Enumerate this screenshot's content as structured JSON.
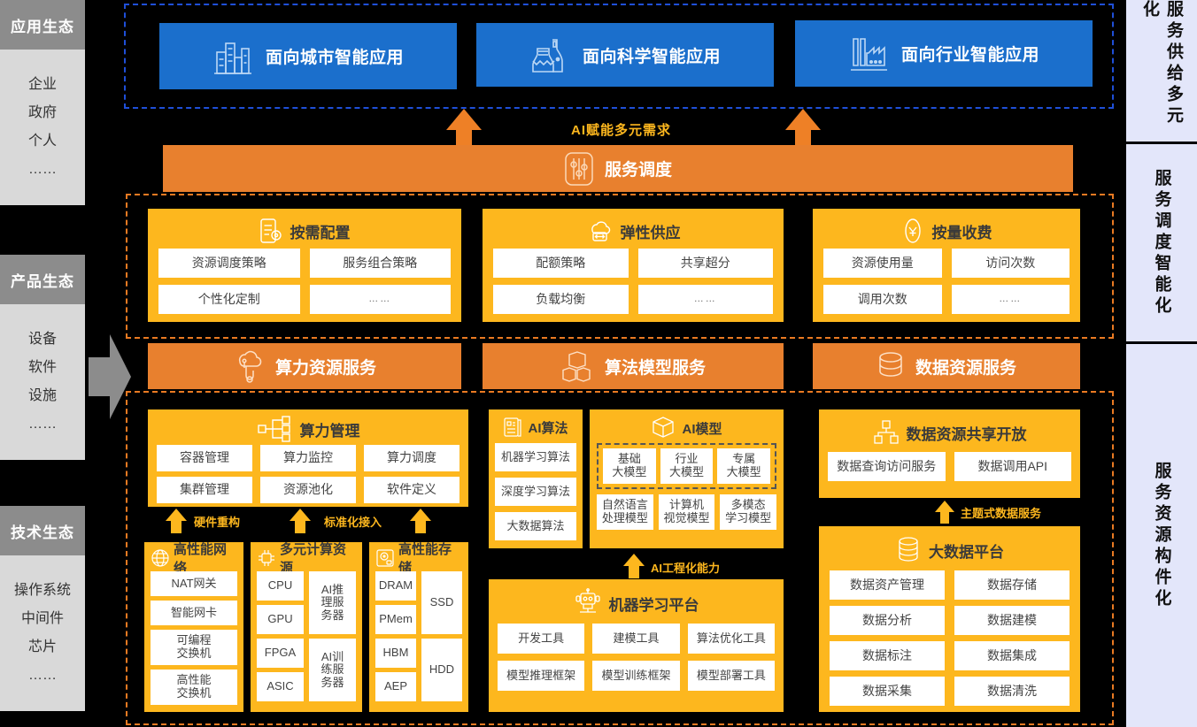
{
  "left_rail": [
    {
      "title": "应用生态",
      "items": [
        "企业",
        "政府",
        "个人",
        "……"
      ]
    },
    {
      "title": "产品生态",
      "items": [
        "设备",
        "软件",
        "设施",
        "……"
      ]
    },
    {
      "title": "技术生态",
      "items": [
        "操作系统",
        "中间件",
        "芯片",
        "……"
      ]
    }
  ],
  "right_rail": [
    "服务供给多元化",
    "服务调度智能化",
    "服务资源构件化"
  ],
  "applications": [
    {
      "label": "面向城市智能应用",
      "icon": "city-buildings-icon"
    },
    {
      "label": "面向科学智能应用",
      "icon": "science-flask-icon"
    },
    {
      "label": "面向行业智能应用",
      "icon": "factory-icon"
    }
  ],
  "connector_labels": {
    "ai_demand": "AI赋能多元需求",
    "hardware_reconstruct": "硬件重构",
    "standard_access": "标准化接入",
    "ai_engineering": "AI工程化能力",
    "thematic_data_service": "主题式数据服务"
  },
  "service_schedule": {
    "label": "服务调度",
    "icon": "sliders-icon"
  },
  "policy_cards": [
    {
      "title": "按需配置",
      "icon": "config-list-icon",
      "items": [
        "资源调度策略",
        "服务组合策略",
        "个性化定制",
        "……"
      ]
    },
    {
      "title": "弹性供应",
      "icon": "elastic-cloud-icon",
      "items": [
        "配额策略",
        "共享超分",
        "负载均衡",
        "……"
      ]
    },
    {
      "title": "按量收费",
      "icon": "yuan-coin-icon",
      "items": [
        "资源使用量",
        "访问次数",
        "调用次数",
        "……"
      ]
    }
  ],
  "service_bars": [
    {
      "label": "算力资源服务",
      "icon": "cloud-compute-icon"
    },
    {
      "label": "算法模型服务",
      "icon": "cubes-icon"
    },
    {
      "label": "数据资源服务",
      "icon": "database-icon"
    }
  ],
  "compute": {
    "management": {
      "title": "算力管理",
      "icon": "network-nodes-icon",
      "items": [
        "容器管理",
        "算力监控",
        "算力调度",
        "集群管理",
        "资源池化",
        "软件定义"
      ]
    },
    "network": {
      "title": "高性能网络",
      "icon": "globe-network-icon",
      "items": [
        "NAT网关",
        "智能网卡",
        "可编程\n交换机",
        "高性能\n交换机"
      ]
    },
    "compute_res": {
      "title": "多元计算资源",
      "icon": "chip-icon",
      "left": [
        "CPU",
        "GPU",
        "FPGA",
        "ASIC"
      ],
      "right": [
        "AI推\n理服\n务器",
        "AI训\n练服\n务器"
      ]
    },
    "storage": {
      "title": "高性能存储",
      "icon": "disk-icon",
      "left": [
        "DRAM",
        "PMem",
        "HBM",
        "AEP"
      ],
      "right": [
        "SSD",
        "HDD"
      ]
    }
  },
  "algorithm": {
    "ai_algo": {
      "title": "AI算法",
      "icon": "algorithm-doc-icon",
      "items": [
        "机器学习算法",
        "深度学习算法",
        "大数据算法"
      ]
    },
    "ai_model": {
      "title": "AI模型",
      "icon": "cube-model-icon",
      "highlighted": [
        "基础\n大模型",
        "行业\n大模型",
        "专属\n大模型"
      ],
      "items": [
        "自然语言\n处理模型",
        "计算机\n视觉模型",
        "多模态\n学习模型"
      ]
    },
    "ml_platform": {
      "title": "机器学习平台",
      "icon": "robot-icon",
      "items": [
        "开发工具",
        "建模工具",
        "算法优化工具",
        "模型推理框架",
        "模型训练框架",
        "模型部署工具"
      ]
    }
  },
  "data": {
    "sharing": {
      "title": "数据资源共享开放",
      "icon": "share-tree-icon",
      "items": [
        "数据查询访问服务",
        "数据调用API"
      ]
    },
    "bigdata": {
      "title": "大数据平台",
      "icon": "database-stack-icon",
      "items": [
        "数据资产管理",
        "数据存储",
        "数据分析",
        "数据建模",
        "数据标注",
        "数据集成",
        "数据采集",
        "数据清洗"
      ]
    }
  },
  "colors": {
    "blue": "#1b6fcc",
    "orange": "#e8802e",
    "yellow": "#fdb71e",
    "rail_gray_head": "#8c8c8c",
    "rail_gray_body": "#d9d9d9",
    "right_rail": "#e3e6fa"
  }
}
